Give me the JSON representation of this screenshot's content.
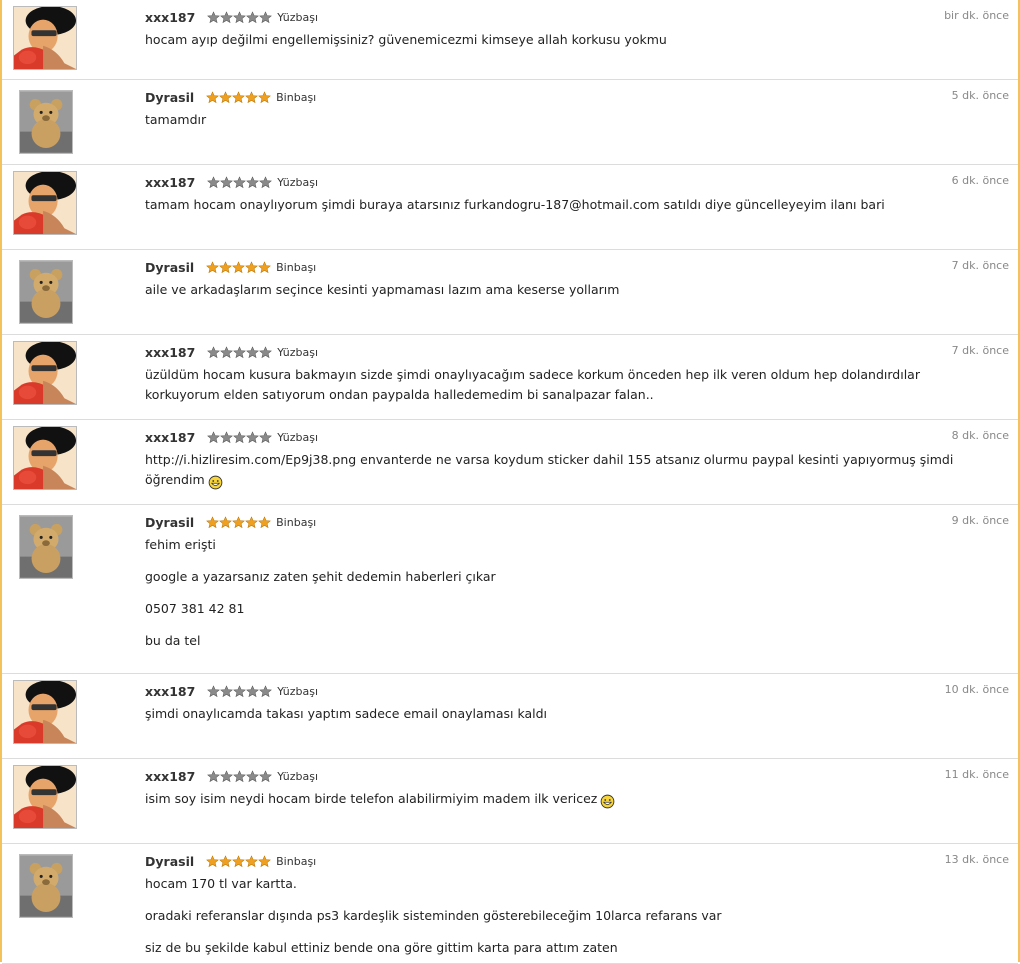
{
  "comments": [
    {
      "user": "xxx187",
      "rank": "Yüzbaşı",
      "avatar": "afro-avatar",
      "stars": 4,
      "time": "bir dk. önce",
      "lines": [
        "hocam ayıp değilmi engellemişsiniz? güvenemicezmi kimseye allah korkusu yokmu"
      ]
    },
    {
      "user": "Dyrasil",
      "rank": "Binbaşı",
      "avatar": "teddy-bear-avatar",
      "stars": 5,
      "time": "5 dk. önce",
      "lines": [
        "tamamdır"
      ]
    },
    {
      "user": "xxx187",
      "rank": "Yüzbaşı",
      "avatar": "afro-avatar",
      "stars": 4,
      "time": "6 dk. önce",
      "lines": [
        "tamam hocam onaylıyorum şimdi buraya atarsınız furkandogru-187@hotmail.com satıldı diye güncelleyeyim ilanı bari"
      ]
    },
    {
      "user": "Dyrasil",
      "rank": "Binbaşı",
      "avatar": "teddy-bear-avatar",
      "stars": 5,
      "time": "7 dk. önce",
      "lines": [
        "aile ve arkadaşlarım seçince kesinti yapmaması lazım ama keserse yollarım"
      ]
    },
    {
      "user": "xxx187",
      "rank": "Yüzbaşı",
      "avatar": "afro-avatar",
      "stars": 4,
      "time": "7 dk. önce",
      "lines": [
        "üzüldüm hocam kusura bakmayın sizde şimdi onaylıyacağım sadece korkum önceden hep ilk veren oldum hep dolandırdılar korkuyorum elden satıyorum ondan paypalda halledemedim bi sanalpazar falan.."
      ]
    },
    {
      "user": "xxx187",
      "rank": "Yüzbaşı",
      "avatar": "afro-avatar",
      "stars": 4,
      "time": "8 dk. önce",
      "link": "http://i.hizliresim.com/Ep9j38.png",
      "lines": [
        " envanterde ne varsa koydum sticker dahil 155 atsanız olurmu paypal kesinti yapıyormuş şimdi öğrendim"
      ],
      "smiley": true
    },
    {
      "user": "Dyrasil",
      "rank": "Binbaşı",
      "avatar": "teddy-bear-avatar",
      "stars": 5,
      "time": "9 dk. önce",
      "lines": [
        "fehim erişti",
        "google a yazarsanız zaten şehit dedemin haberleri çıkar",
        "0507 381 42 81",
        "bu da tel"
      ]
    },
    {
      "user": "xxx187",
      "rank": "Yüzbaşı",
      "avatar": "afro-avatar",
      "stars": 4,
      "time": "10 dk. önce",
      "lines": [
        "şimdi onaylıcamda takası yaptım sadece email onaylaması kaldı"
      ]
    },
    {
      "user": "xxx187",
      "rank": "Yüzbaşı",
      "avatar": "afro-avatar",
      "stars": 4,
      "time": "11 dk. önce",
      "lines": [
        "isim soy isim neydi hocam birde telefon alabilirmiyim madem ilk vericez"
      ],
      "smiley": true
    },
    {
      "user": "Dyrasil",
      "rank": "Binbaşı",
      "avatar": "teddy-bear-avatar",
      "stars": 5,
      "time": "13 dk. önce",
      "lines": [
        "hocam 170 tl var kartta.",
        "oradaki referanslar dışında ps3 kardeşlik sisteminden gösterebileceğim 10larca refarans var",
        "siz de bu şekilde kabul ettiniz bende ona göre gittim karta para attım zaten"
      ]
    }
  ],
  "colors": {
    "star_gold": "#f0a020",
    "star_gray": "#8a8a8a",
    "border": "#f3c25a"
  }
}
